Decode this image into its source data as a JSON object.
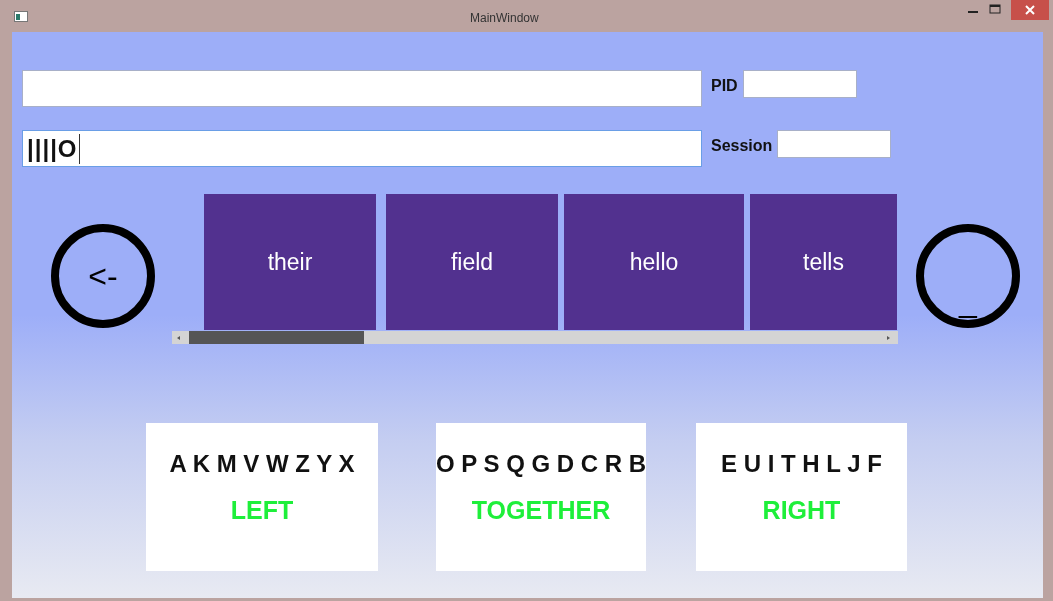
{
  "window": {
    "title": "MainWindow"
  },
  "rows": [
    {
      "label": "PID",
      "focused": false
    },
    {
      "label": "Session",
      "value": "||||O",
      "focused": true
    }
  ],
  "backspace_button": {
    "label": "<-"
  },
  "suggestions": [
    {
      "word": "their"
    },
    {
      "word": "field"
    },
    {
      "word": "hello"
    },
    {
      "word": "tells"
    }
  ],
  "space_button": {
    "label": "_"
  },
  "groups": [
    {
      "letters": "A K M V W Z Y X",
      "label": "LEFT"
    },
    {
      "letters": "O P S Q G D C R B",
      "label": "TOGETHER"
    },
    {
      "letters": "E U I T H L J F",
      "label": "RIGHT"
    }
  ]
}
